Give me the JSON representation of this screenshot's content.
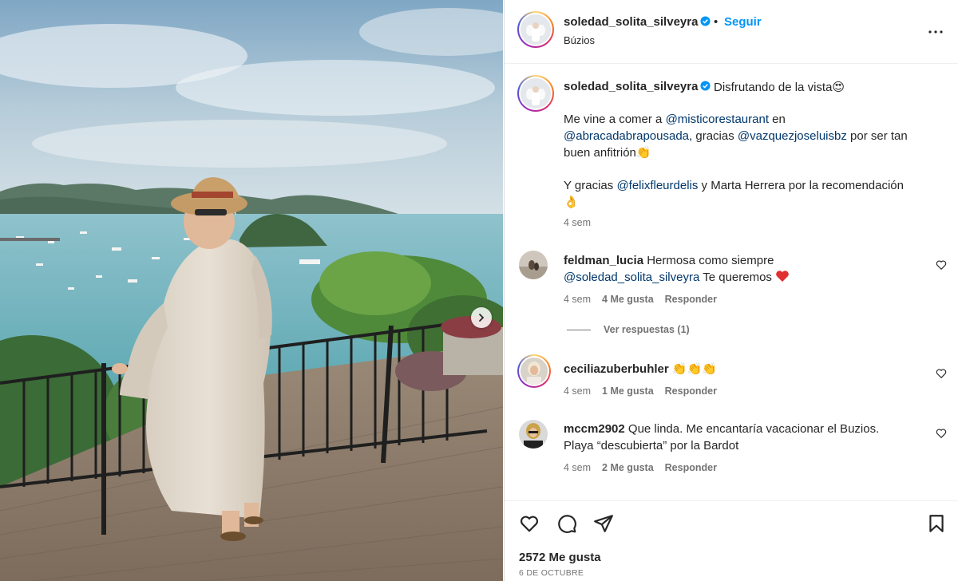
{
  "post": {
    "image_alt": "",
    "next_icon": "chevron-right-icon"
  },
  "header": {
    "username": "soledad_solita_silveyra",
    "separator": "•",
    "follow_label": "Seguir",
    "location": "Búzios",
    "more_icon": "more-horizontal-icon"
  },
  "caption": {
    "username": "soledad_solita_silveyra",
    "first_line": "Disfrutando de la vista😍",
    "p1_a": "Me vine a comer a ",
    "p1_mention1": "@misticorestaurant",
    "p1_b": " en",
    "p1_mention2": "@abracadabrapousada",
    "p1_c": ", gracias ",
    "p1_mention3": "@vazquezjoseluisbz",
    "p1_d": " por ser tan",
    "p1_e": "buen anfitrión👏",
    "p2_a": "Y gracias ",
    "p2_mention": "@felixfleurdelis",
    "p2_b": " y Marta Herrera por la recomendación",
    "p2_emoji": "👌",
    "time": "4 sem"
  },
  "comments": [
    {
      "username": "feldman_lucia",
      "text": "Hermosa como siempre",
      "mention": "@soledad_solita_silveyra",
      "text2": " Te queremos ",
      "time": "4 sem",
      "likes": "4 Me gusta",
      "reply": "Responder",
      "view_replies": "Ver respuestas (1)"
    },
    {
      "username": "ceciliazuberbuhler",
      "text": "👏👏👏",
      "time": "4 sem",
      "likes": "1 Me gusta",
      "reply": "Responder"
    },
    {
      "username": "mccm2902",
      "text": "Que linda. Me encantaría vacacionar el Buzios.",
      "text2": "Playa “descubierta” por la Bardot",
      "time": "4 sem",
      "likes": "2 Me gusta",
      "reply": "Responder"
    }
  ],
  "footer": {
    "likes": "2572 Me gusta",
    "date": "6 DE OCTUBRE"
  },
  "colors": {
    "link_blue": "#0095f6",
    "mention_blue": "#00376b",
    "muted": "#737373",
    "text": "#262626",
    "heart_red": "#ed4956"
  }
}
